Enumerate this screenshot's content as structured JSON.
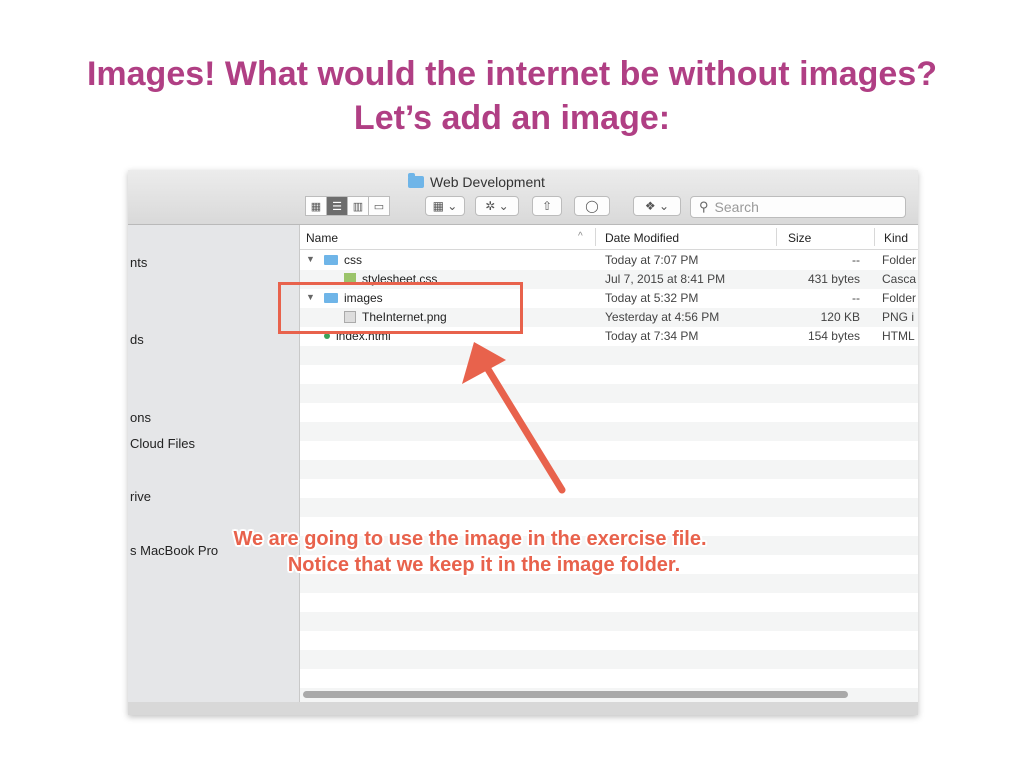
{
  "slide": {
    "title_line1": "Images! What would the internet be without images?",
    "title_line2": "Let’s add an image:"
  },
  "window": {
    "title": "Web Development",
    "search_placeholder": "Search"
  },
  "columns": {
    "name": "Name",
    "date": "Date Modified",
    "size": "Size",
    "kind": "Kind"
  },
  "sidebar": {
    "items": [
      "nts",
      "ds",
      "ons",
      "Cloud Files",
      "rive",
      "s MacBook Pro"
    ]
  },
  "files": [
    {
      "name": "css",
      "date": "Today at 7:07 PM",
      "size": "--",
      "kind": "Folder",
      "type": "folder",
      "expanded": true,
      "indent": 0
    },
    {
      "name": "stylesheet.css",
      "date": "Jul 7, 2015 at 8:41 PM",
      "size": "431 bytes",
      "kind": "Casca",
      "type": "css",
      "indent": 1
    },
    {
      "name": "images",
      "date": "Today at 5:32 PM",
      "size": "--",
      "kind": "Folder",
      "type": "folder",
      "expanded": true,
      "indent": 0
    },
    {
      "name": "TheInternet.png",
      "date": "Yesterday at 4:56 PM",
      "size": "120 KB",
      "kind": "PNG i",
      "type": "png",
      "indent": 1
    },
    {
      "name": "index.html",
      "date": "Today at 7:34 PM",
      "size": "154 bytes",
      "kind": "HTML",
      "type": "html",
      "indent": 0
    }
  ],
  "annotation": {
    "line1": "We are going to use the image in the exercise file.",
    "line2": "Notice that we keep it in the image folder.",
    "color": "#e8624c"
  },
  "colors": {
    "title": "#b03f84",
    "folder": "#6fb5e8"
  }
}
